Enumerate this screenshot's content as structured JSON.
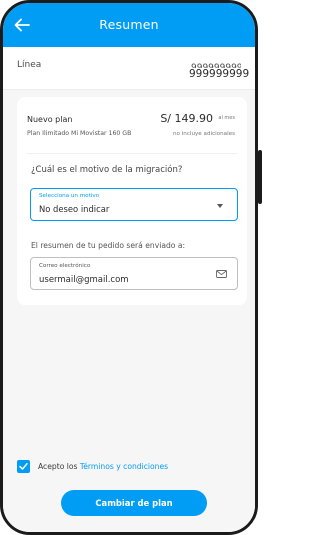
{
  "header": {
    "title": "Resumen",
    "back_icon": "arrow-left-icon"
  },
  "line": {
    "label": "Línea",
    "number": "999999999"
  },
  "plan": {
    "title": "Nuevo plan",
    "name": "Plan Ilimitado Mi Movistar 160 GB",
    "price": "S/ 149.90",
    "period": "al mes",
    "taxes_note": "no incluye adicionales"
  },
  "migration": {
    "question": "¿Cuál es el motivo de la migración?",
    "select_caption": "Selecciona un motivo",
    "select_value": "No deseo indicar"
  },
  "email": {
    "note": "El resumen de tu pedido será enviado a:",
    "caption": "Correo electrónico",
    "value": "usermail@gmail.com",
    "icon": "mail-icon"
  },
  "terms": {
    "checked": true,
    "prefix": "Acepto los ",
    "link": "Términos y condiciones"
  },
  "cta": {
    "label": "Cambiar de plan"
  },
  "colors": {
    "primary": "#019df4",
    "background": "#f6f6f6",
    "frame": "#1b1b1b"
  }
}
